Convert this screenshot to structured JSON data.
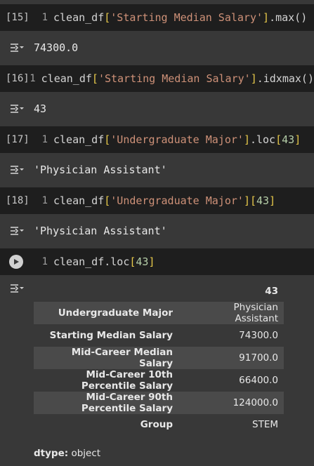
{
  "cells": [
    {
      "exec": "[15]",
      "line": "1",
      "code": {
        "var": "clean_df",
        "open": "[",
        "str": "'Starting Median Salary'",
        "close": "]",
        "rest": ".max()"
      },
      "output": "74300.0"
    },
    {
      "exec": "[16]",
      "line": "1",
      "code": {
        "var": "clean_df",
        "open": "[",
        "str": "'Starting Median Salary'",
        "close": "]",
        "rest": ".idxmax()"
      },
      "output": "43"
    },
    {
      "exec": "[17]",
      "line": "1",
      "code": {
        "var": "clean_df",
        "open": "[",
        "str": "'Undergraduate Major'",
        "close": "]",
        "rest": ".loc",
        "open2": "[",
        "num": "43",
        "close2": "]"
      },
      "output": "'Physician Assistant'"
    },
    {
      "exec": "[18]",
      "line": "1",
      "code": {
        "var": "clean_df",
        "open": "[",
        "str": "'Undergraduate Major'",
        "close": "]",
        "open2": "[",
        "num": "43",
        "close2": "]"
      },
      "output": "'Physician Assistant'"
    },
    {
      "line": "1",
      "code": {
        "var": "clean_df.loc",
        "open": "[",
        "num": "43",
        "close": "]"
      }
    }
  ],
  "table": {
    "header": "43",
    "rows": [
      {
        "label": "Undergraduate Major",
        "value": "Physician Assistant"
      },
      {
        "label": "Starting Median Salary",
        "value": "74300.0"
      },
      {
        "label": "Mid-Career Median Salary",
        "value": "91700.0"
      },
      {
        "label": "Mid-Career 10th Percentile Salary",
        "value": "66400.0"
      },
      {
        "label": "Mid-Career 90th Percentile Salary",
        "value": "124000.0"
      },
      {
        "label": "Group",
        "value": "STEM"
      }
    ]
  },
  "dtype": {
    "label": "dtype:",
    "value": "object"
  },
  "icons": {
    "output": "output-toggle-icon",
    "run": "run-play-icon"
  }
}
